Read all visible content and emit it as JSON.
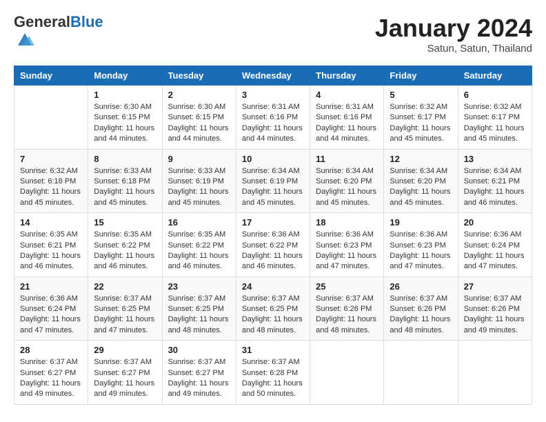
{
  "header": {
    "logo_general": "General",
    "logo_blue": "Blue",
    "month_title": "January 2024",
    "location": "Satun, Satun, Thailand"
  },
  "weekdays": [
    "Sunday",
    "Monday",
    "Tuesday",
    "Wednesday",
    "Thursday",
    "Friday",
    "Saturday"
  ],
  "weeks": [
    [
      {
        "day": "",
        "info": ""
      },
      {
        "day": "1",
        "info": "Sunrise: 6:30 AM\nSunset: 6:15 PM\nDaylight: 11 hours\nand 44 minutes."
      },
      {
        "day": "2",
        "info": "Sunrise: 6:30 AM\nSunset: 6:15 PM\nDaylight: 11 hours\nand 44 minutes."
      },
      {
        "day": "3",
        "info": "Sunrise: 6:31 AM\nSunset: 6:16 PM\nDaylight: 11 hours\nand 44 minutes."
      },
      {
        "day": "4",
        "info": "Sunrise: 6:31 AM\nSunset: 6:16 PM\nDaylight: 11 hours\nand 44 minutes."
      },
      {
        "day": "5",
        "info": "Sunrise: 6:32 AM\nSunset: 6:17 PM\nDaylight: 11 hours\nand 45 minutes."
      },
      {
        "day": "6",
        "info": "Sunrise: 6:32 AM\nSunset: 6:17 PM\nDaylight: 11 hours\nand 45 minutes."
      }
    ],
    [
      {
        "day": "7",
        "info": "Sunrise: 6:32 AM\nSunset: 6:18 PM\nDaylight: 11 hours\nand 45 minutes."
      },
      {
        "day": "8",
        "info": "Sunrise: 6:33 AM\nSunset: 6:18 PM\nDaylight: 11 hours\nand 45 minutes."
      },
      {
        "day": "9",
        "info": "Sunrise: 6:33 AM\nSunset: 6:19 PM\nDaylight: 11 hours\nand 45 minutes."
      },
      {
        "day": "10",
        "info": "Sunrise: 6:34 AM\nSunset: 6:19 PM\nDaylight: 11 hours\nand 45 minutes."
      },
      {
        "day": "11",
        "info": "Sunrise: 6:34 AM\nSunset: 6:20 PM\nDaylight: 11 hours\nand 45 minutes."
      },
      {
        "day": "12",
        "info": "Sunrise: 6:34 AM\nSunset: 6:20 PM\nDaylight: 11 hours\nand 45 minutes."
      },
      {
        "day": "13",
        "info": "Sunrise: 6:34 AM\nSunset: 6:21 PM\nDaylight: 11 hours\nand 46 minutes."
      }
    ],
    [
      {
        "day": "14",
        "info": "Sunrise: 6:35 AM\nSunset: 6:21 PM\nDaylight: 11 hours\nand 46 minutes."
      },
      {
        "day": "15",
        "info": "Sunrise: 6:35 AM\nSunset: 6:22 PM\nDaylight: 11 hours\nand 46 minutes."
      },
      {
        "day": "16",
        "info": "Sunrise: 6:35 AM\nSunset: 6:22 PM\nDaylight: 11 hours\nand 46 minutes."
      },
      {
        "day": "17",
        "info": "Sunrise: 6:36 AM\nSunset: 6:22 PM\nDaylight: 11 hours\nand 46 minutes."
      },
      {
        "day": "18",
        "info": "Sunrise: 6:36 AM\nSunset: 6:23 PM\nDaylight: 11 hours\nand 47 minutes."
      },
      {
        "day": "19",
        "info": "Sunrise: 6:36 AM\nSunset: 6:23 PM\nDaylight: 11 hours\nand 47 minutes."
      },
      {
        "day": "20",
        "info": "Sunrise: 6:36 AM\nSunset: 6:24 PM\nDaylight: 11 hours\nand 47 minutes."
      }
    ],
    [
      {
        "day": "21",
        "info": "Sunrise: 6:36 AM\nSunset: 6:24 PM\nDaylight: 11 hours\nand 47 minutes."
      },
      {
        "day": "22",
        "info": "Sunrise: 6:37 AM\nSunset: 6:25 PM\nDaylight: 11 hours\nand 47 minutes."
      },
      {
        "day": "23",
        "info": "Sunrise: 6:37 AM\nSunset: 6:25 PM\nDaylight: 11 hours\nand 48 minutes."
      },
      {
        "day": "24",
        "info": "Sunrise: 6:37 AM\nSunset: 6:25 PM\nDaylight: 11 hours\nand 48 minutes."
      },
      {
        "day": "25",
        "info": "Sunrise: 6:37 AM\nSunset: 6:26 PM\nDaylight: 11 hours\nand 48 minutes."
      },
      {
        "day": "26",
        "info": "Sunrise: 6:37 AM\nSunset: 6:26 PM\nDaylight: 11 hours\nand 48 minutes."
      },
      {
        "day": "27",
        "info": "Sunrise: 6:37 AM\nSunset: 6:26 PM\nDaylight: 11 hours\nand 49 minutes."
      }
    ],
    [
      {
        "day": "28",
        "info": "Sunrise: 6:37 AM\nSunset: 6:27 PM\nDaylight: 11 hours\nand 49 minutes."
      },
      {
        "day": "29",
        "info": "Sunrise: 6:37 AM\nSunset: 6:27 PM\nDaylight: 11 hours\nand 49 minutes."
      },
      {
        "day": "30",
        "info": "Sunrise: 6:37 AM\nSunset: 6:27 PM\nDaylight: 11 hours\nand 49 minutes."
      },
      {
        "day": "31",
        "info": "Sunrise: 6:37 AM\nSunset: 6:28 PM\nDaylight: 11 hours\nand 50 minutes."
      },
      {
        "day": "",
        "info": ""
      },
      {
        "day": "",
        "info": ""
      },
      {
        "day": "",
        "info": ""
      }
    ]
  ]
}
